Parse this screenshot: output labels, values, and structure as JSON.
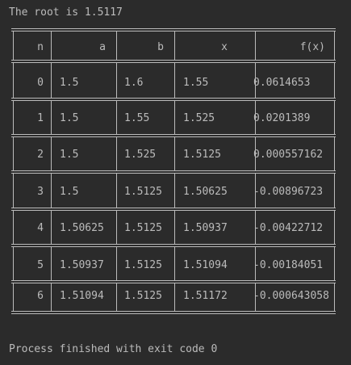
{
  "console": {
    "root_text": "The root is 1.5117",
    "exit_text": "Process finished with exit code 0"
  },
  "table": {
    "headers": [
      "n",
      "a",
      "b",
      "x",
      "f(x)"
    ],
    "rows": [
      [
        "0",
        "1.5",
        "1.6",
        "1.55",
        "0.0614653"
      ],
      [
        "1",
        "1.5",
        "1.55",
        "1.525",
        "0.0201389"
      ],
      [
        "2",
        "1.5",
        "1.525",
        "1.5125",
        "0.000557162"
      ],
      [
        "3",
        "1.5",
        "1.5125",
        "1.50625",
        "-0.00896723"
      ],
      [
        "4",
        "1.50625",
        "1.5125",
        "1.50937",
        "-0.00422712"
      ],
      [
        "5",
        "1.50937",
        "1.5125",
        "1.51094",
        "-0.00184051"
      ],
      [
        "6",
        "1.51094",
        "1.5125",
        "1.51172",
        "-0.000643058"
      ]
    ]
  },
  "colors": {
    "background": "#2b2b2b",
    "text": "#bbbbbb",
    "border": "#bbbbbb"
  }
}
